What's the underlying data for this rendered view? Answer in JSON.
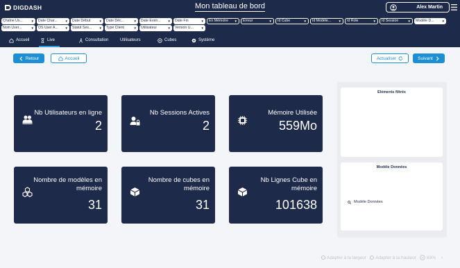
{
  "app": {
    "logo_text": "DIGDASH",
    "title": "Mon tableau de bord"
  },
  "user": {
    "name": "Alex Martin"
  },
  "filters": [
    {
      "label": "Chaîne Us..."
    },
    {
      "label": "Date Char..."
    },
    {
      "label": "Date Début"
    },
    {
      "label": "Date Déc..."
    },
    {
      "label": "Date Evén..."
    },
    {
      "label": "Date Fin"
    },
    {
      "label": "En Mémoire"
    },
    {
      "label": "Erreur"
    },
    {
      "label": "Id Cube"
    },
    {
      "label": "Id Modèle..."
    },
    {
      "label": "Id Role"
    },
    {
      "label": "Id Session"
    },
    {
      "label": "Modèle D..."
    },
    {
      "label": "Nom User..."
    },
    {
      "label": "OS User A..."
    },
    {
      "label": "Statut Ses..."
    },
    {
      "label": "Type Client"
    },
    {
      "label": "Utilisateur"
    },
    {
      "label": "Version U..."
    }
  ],
  "nav": [
    {
      "label": "Accueil",
      "icon": "home-icon"
    },
    {
      "label": "Live",
      "icon": "hourglass-icon"
    },
    {
      "label": "Consultation",
      "icon": "person-walk-icon"
    },
    {
      "label": "Utilisateurs",
      "icon": ""
    },
    {
      "label": "Cubes",
      "icon": "cog-circle-icon"
    },
    {
      "label": "Système",
      "icon": "gear-icon"
    }
  ],
  "actions": {
    "back": "Retour",
    "home": "Accueil",
    "refresh": "Actualiser",
    "next": "Suivant"
  },
  "kpis": [
    {
      "label_lines": [
        "Nb Utilisateurs en ligne"
      ],
      "value": "2",
      "icon": "users-icon"
    },
    {
      "label_lines": [
        "Nb Sessions Actives"
      ],
      "value": "2",
      "icon": "user-lock-icon"
    },
    {
      "label_lines": [
        "Mémoire Utilisée"
      ],
      "value": "559Mo",
      "icon": "chip-icon"
    },
    {
      "label_lines": [
        "Nombre de modèles en",
        "mémoire"
      ],
      "value": "31",
      "icon": "cubes-icon"
    },
    {
      "label_lines": [
        "Nombre de cubes en",
        "mémoire"
      ],
      "value": "31",
      "icon": "cube-icon"
    },
    {
      "label_lines": [
        "Nb Lignes Cube en",
        "mémoire"
      ],
      "value": "101638",
      "icon": "cube-icon"
    }
  ],
  "side": {
    "filtered_title": "Eléments filtrés",
    "models_title": "Modèle Données",
    "search_placeholder": "Modèle Données"
  },
  "footer": {
    "fit_width": "Adapter à la largeur",
    "fit_height": "Adapter à la hauteur",
    "zoom": "83%"
  },
  "colors": {
    "navy": "#1e2a4a",
    "accent": "#1d8fd6",
    "background": "#f4f5f8"
  }
}
